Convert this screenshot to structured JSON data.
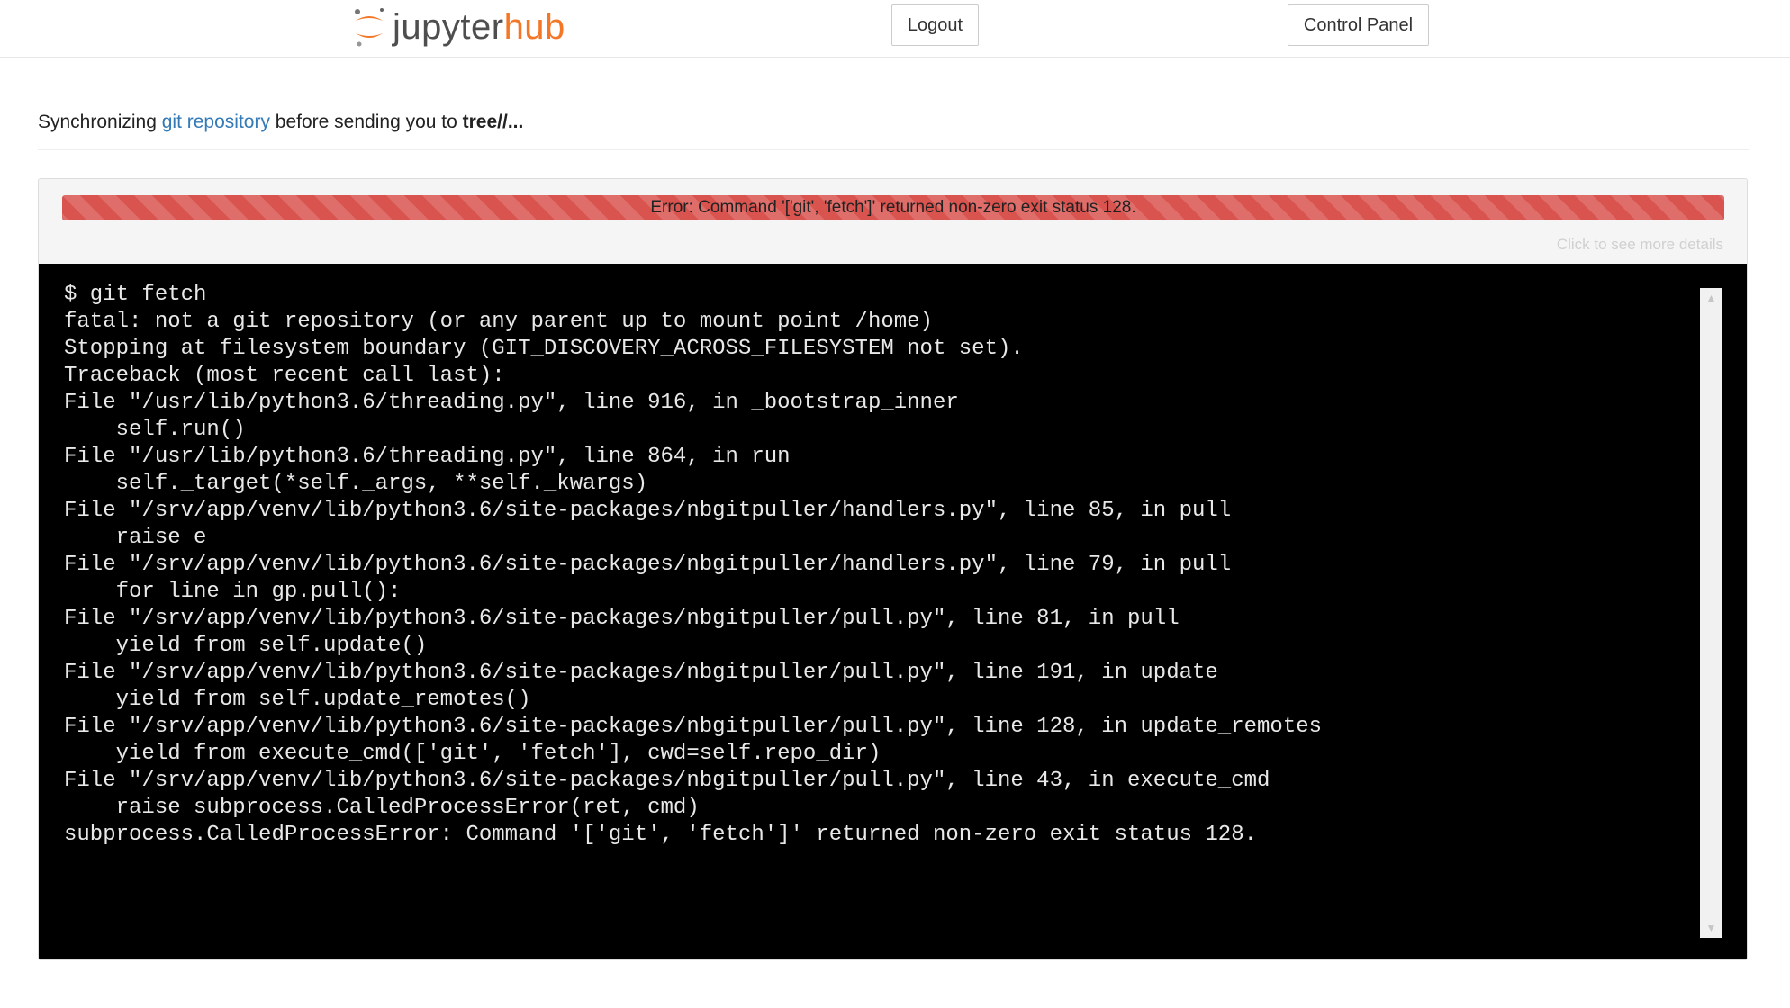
{
  "header": {
    "logo": {
      "part1": "jupyter",
      "part2": "hub"
    },
    "logout_label": "Logout",
    "control_panel_label": "Control Panel"
  },
  "sync": {
    "prefix": "Synchronizing ",
    "link_text": "git repository",
    "middle": " before sending you to ",
    "target": "tree//..."
  },
  "progress": {
    "error_text": "Error: Command '['git', 'fetch']' returned non-zero exit status 128.",
    "fill_percent": 100,
    "color": "#d9534f"
  },
  "details_link": "Click to see more details",
  "terminal": {
    "lines": [
      "$ git fetch",
      "fatal: not a git repository (or any parent up to mount point /home)",
      "Stopping at filesystem boundary (GIT_DISCOVERY_ACROSS_FILESYSTEM not set).",
      "Traceback (most recent call last):",
      "File \"/usr/lib/python3.6/threading.py\", line 916, in _bootstrap_inner",
      "    self.run()",
      "File \"/usr/lib/python3.6/threading.py\", line 864, in run",
      "    self._target(*self._args, **self._kwargs)",
      "File \"/srv/app/venv/lib/python3.6/site-packages/nbgitpuller/handlers.py\", line 85, in pull",
      "    raise e",
      "File \"/srv/app/venv/lib/python3.6/site-packages/nbgitpuller/handlers.py\", line 79, in pull",
      "    for line in gp.pull():",
      "File \"/srv/app/venv/lib/python3.6/site-packages/nbgitpuller/pull.py\", line 81, in pull",
      "    yield from self.update()",
      "File \"/srv/app/venv/lib/python3.6/site-packages/nbgitpuller/pull.py\", line 191, in update",
      "    yield from self.update_remotes()",
      "File \"/srv/app/venv/lib/python3.6/site-packages/nbgitpuller/pull.py\", line 128, in update_remotes",
      "    yield from execute_cmd(['git', 'fetch'], cwd=self.repo_dir)",
      "File \"/srv/app/venv/lib/python3.6/site-packages/nbgitpuller/pull.py\", line 43, in execute_cmd",
      "    raise subprocess.CalledProcessError(ret, cmd)",
      "subprocess.CalledProcessError: Command '['git', 'fetch']' returned non-zero exit status 128."
    ]
  },
  "colors": {
    "accent_orange": "#f37726",
    "link_blue": "#337ab7",
    "terminal_bg": "#000000"
  }
}
